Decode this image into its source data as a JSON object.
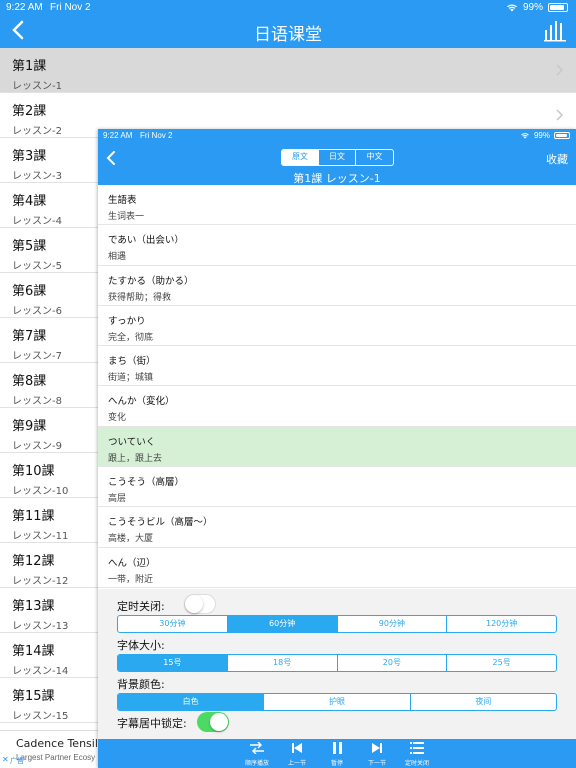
{
  "status_bar": {
    "time": "9:22 AM",
    "date": "Fri Nov 2",
    "battery": "99%"
  },
  "header": {
    "title": "日语课堂"
  },
  "lessons": [
    {
      "title": "第1課",
      "subtitle": "レッスン-1"
    },
    {
      "title": "第2課",
      "subtitle": "レッスン-2"
    },
    {
      "title": "第3課",
      "subtitle": "レッスン-3"
    },
    {
      "title": "第4課",
      "subtitle": "レッスン-4"
    },
    {
      "title": "第5課",
      "subtitle": "レッスン-5"
    },
    {
      "title": "第6課",
      "subtitle": "レッスン-6"
    },
    {
      "title": "第7課",
      "subtitle": "レッスン-7"
    },
    {
      "title": "第8課",
      "subtitle": "レッスン-8"
    },
    {
      "title": "第9課",
      "subtitle": "レッスン-9"
    },
    {
      "title": "第10課",
      "subtitle": "レッスン-10"
    },
    {
      "title": "第11課",
      "subtitle": "レッスン-11"
    },
    {
      "title": "第12課",
      "subtitle": "レッスン-12"
    },
    {
      "title": "第13課",
      "subtitle": "レッスン-13"
    },
    {
      "title": "第14課",
      "subtitle": "レッスン-14"
    },
    {
      "title": "第15課",
      "subtitle": "レッスン-15"
    }
  ],
  "ad": {
    "title": "Cadence Tensilic",
    "subtitle": "Largest Partner Ecosy",
    "label": "广告"
  },
  "modal": {
    "status_bar": {
      "time": "9:22 AM",
      "date": "Fri Nov 2",
      "battery": "99%"
    },
    "tabs": [
      "原文",
      "日文",
      "中文"
    ],
    "favorite": "收藏",
    "lesson_title": "第1課  レッスン-1",
    "vocab": [
      {
        "jp": "生語表",
        "zh": "生词表一"
      },
      {
        "jp": "であい（出会い）",
        "zh": "相遇"
      },
      {
        "jp": "たすかる（助かる）",
        "zh": "获得帮助；得救"
      },
      {
        "jp": "すっかり",
        "zh": "完全，彻底"
      },
      {
        "jp": "まち（街）",
        "zh": "街道；城镇"
      },
      {
        "jp": "へんか（変化）",
        "zh": "变化"
      },
      {
        "jp": "ついていく",
        "zh": "跟上，跟上去"
      },
      {
        "jp": "こうそう（高層）",
        "zh": "高层"
      },
      {
        "jp": "こうそうビル（高層〜）",
        "zh": "高楼，大厦"
      },
      {
        "jp": "へん（辺）",
        "zh": "一带，附近"
      }
    ],
    "settings": {
      "timer_label": "定时关闭:",
      "timer_options": [
        "30分钟",
        "60分钟",
        "90分钟",
        "120分钟"
      ],
      "font_label": "字体大小:",
      "font_options": [
        "15号",
        "18号",
        "20号",
        "25号"
      ],
      "bg_label": "背景颜色:",
      "bg_options": [
        "白色",
        "护眼",
        "夜间"
      ],
      "lock_label": "字幕居中锁定:"
    },
    "player": [
      "顺序播放",
      "上一节",
      "暂停",
      "下一节",
      "定时关闭"
    ]
  },
  "colors": {
    "accent": "#2a9af2",
    "highlight_row": "#d6f0d6",
    "toggle_on": "#4cd964"
  }
}
